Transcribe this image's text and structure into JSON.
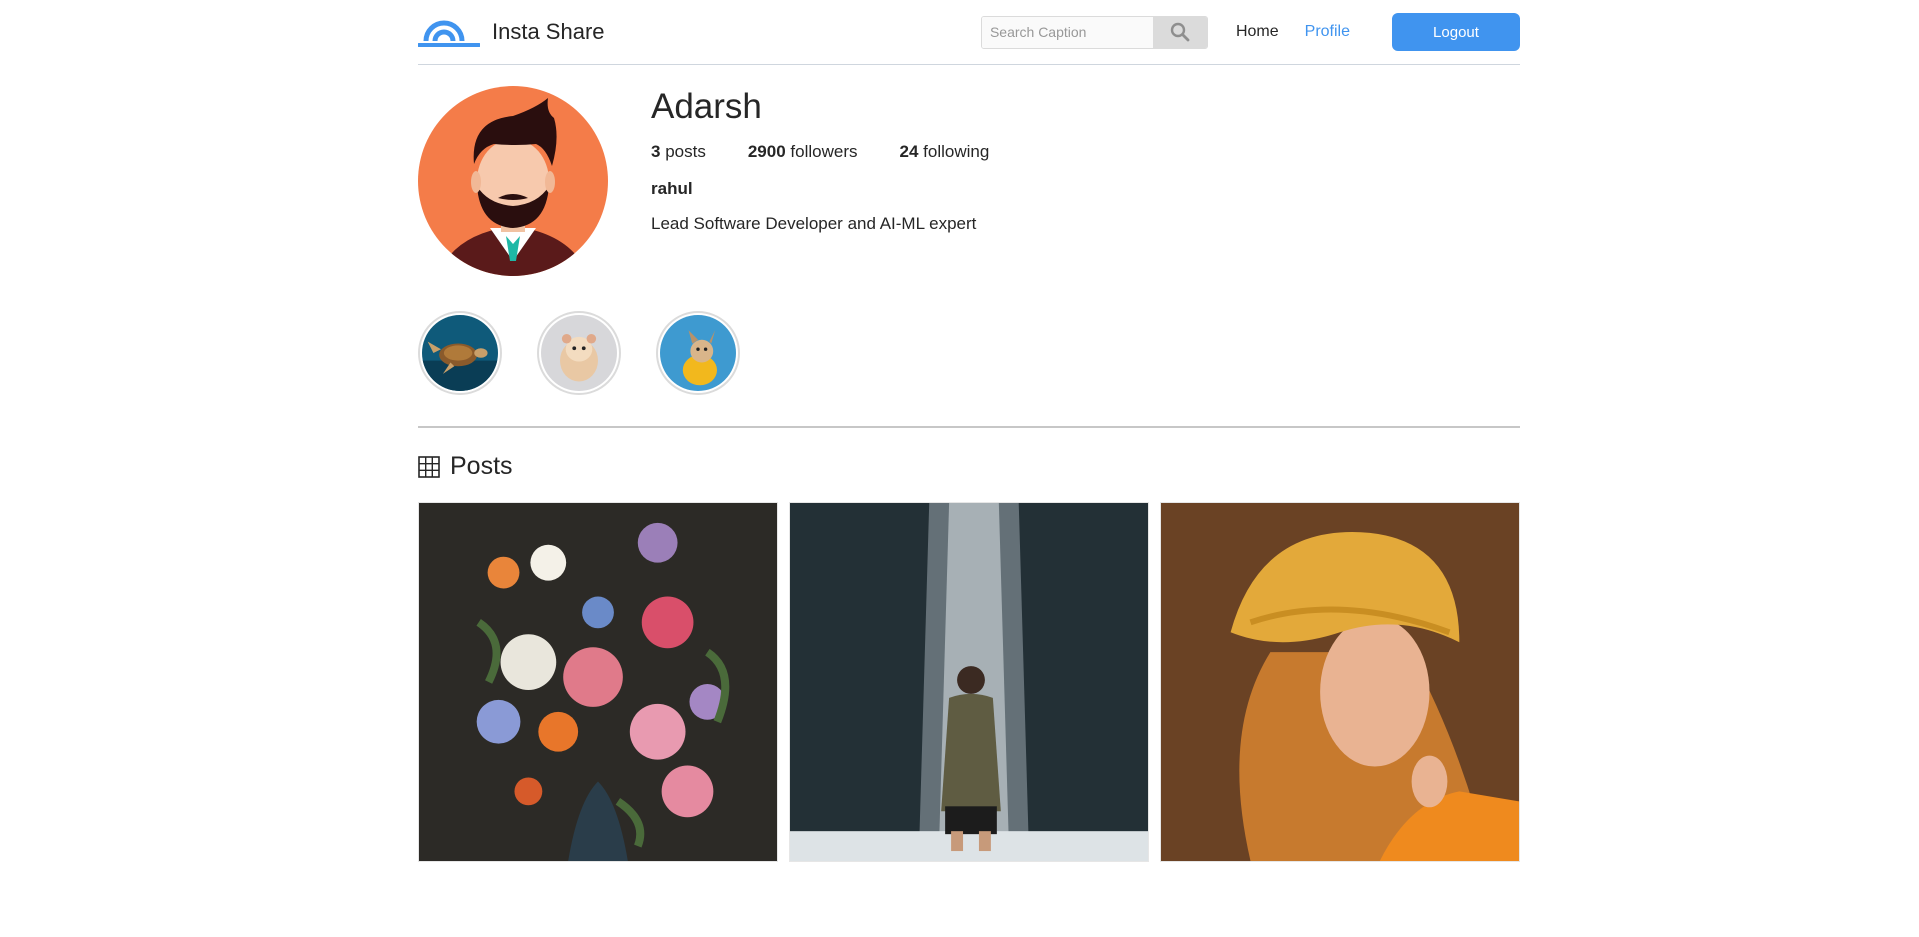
{
  "header": {
    "brand_name": "Insta Share",
    "search_placeholder": "Search Caption",
    "nav_home": "Home",
    "nav_profile": "Profile",
    "logout_label": "Logout"
  },
  "profile": {
    "username": "Adarsh",
    "posts_count": "3",
    "posts_label": "posts",
    "followers_count": "2900",
    "followers_label": "followers",
    "following_count": "24",
    "following_label": "following",
    "user_id": "rahul",
    "bio": "Lead Software Developer and AI-ML expert"
  },
  "stories": [
    {
      "icon": "turtle-story-icon"
    },
    {
      "icon": "hamster-story-icon"
    },
    {
      "icon": "dog-story-icon"
    }
  ],
  "posts": {
    "title": "Posts",
    "items": [
      {
        "subject": "flower-bouquet-painting"
      },
      {
        "subject": "man-at-waterfall"
      },
      {
        "subject": "woman-yellow-beanie"
      }
    ]
  },
  "colors": {
    "accent": "#4094ef",
    "avatar_bg": "#f47c49",
    "divider": "#c7c7c7"
  }
}
